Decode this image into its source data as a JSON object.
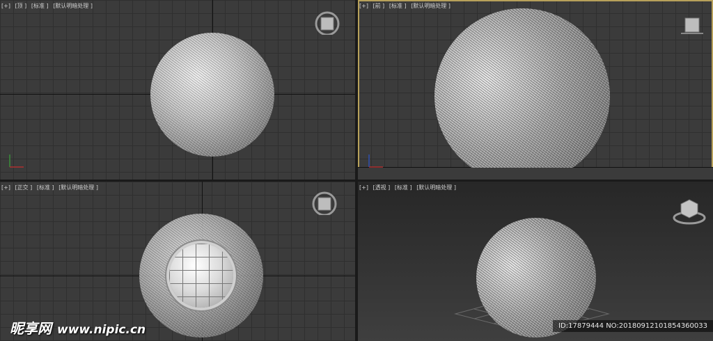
{
  "viewports": {
    "top": {
      "tags": [
        "[+]",
        "[顶 ]",
        "[标准 ]",
        "[默认明暗处理 ]"
      ]
    },
    "front": {
      "tags": [
        "[+]",
        "[前 ]",
        "[标准 ]",
        "[默认明暗处理 ]"
      ]
    },
    "ortho": {
      "tags": [
        "[+]",
        "[正交 ]",
        "[标准 ]",
        "[默认明暗处理 ]"
      ]
    },
    "perspective": {
      "tags": [
        "[+]",
        "[透视 ]",
        "[标准 ]",
        "[默认明暗处理 ]"
      ]
    }
  },
  "watermark": {
    "brand": "昵享网",
    "site": "www.nipic.cn"
  },
  "image_id": "ID:17879444 NO:20180912101854360033",
  "colors": {
    "grid_bg": "#3b3b3b",
    "active_border": "#b8a15a"
  },
  "icons": [
    "viewcube-icon",
    "axis-tripod-icon"
  ]
}
